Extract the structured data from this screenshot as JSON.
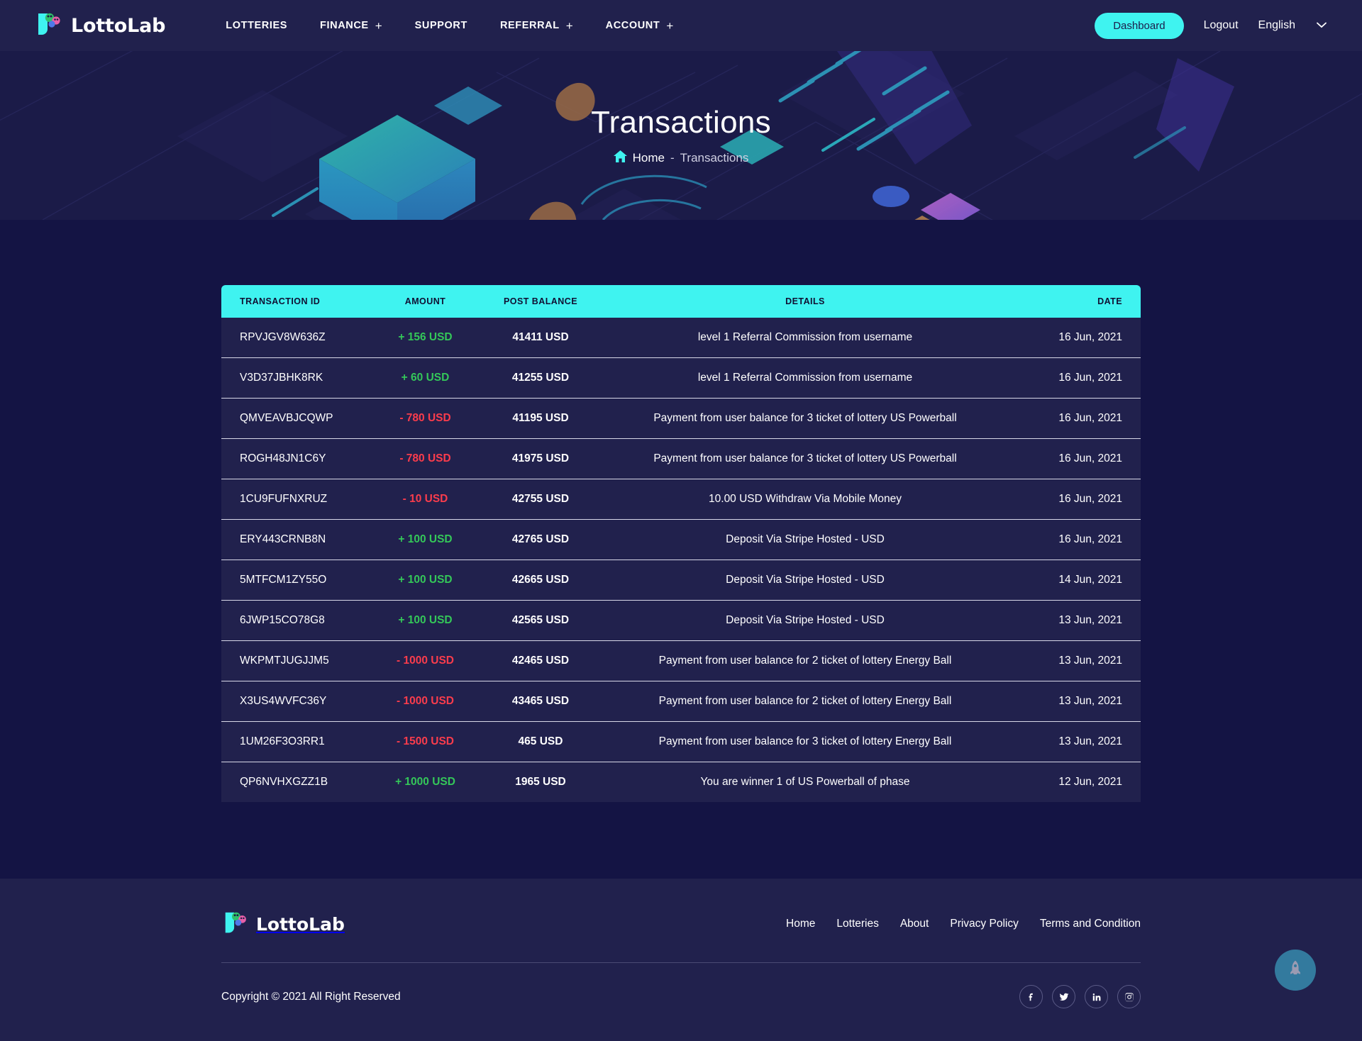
{
  "brand": {
    "name": "LottoLab"
  },
  "nav": {
    "items": [
      {
        "label": "LOTTERIES",
        "has_plus": false
      },
      {
        "label": "FINANCE",
        "has_plus": true
      },
      {
        "label": "SUPPORT",
        "has_plus": false
      },
      {
        "label": "REFERRAL",
        "has_plus": true
      },
      {
        "label": "ACCOUNT",
        "has_plus": true
      }
    ],
    "dashboard_label": "Dashboard",
    "logout_label": "Logout",
    "language_label": "English"
  },
  "banner": {
    "title": "Transactions",
    "breadcrumb_home": "Home",
    "breadcrumb_separator": "-",
    "breadcrumb_current": "Transactions"
  },
  "table": {
    "columns": [
      "TRANSACTION ID",
      "AMOUNT",
      "POST BALANCE",
      "DETAILS",
      "DATE"
    ],
    "rows": [
      {
        "id": "RPVJGV8W636Z",
        "amount": "+ 156 USD",
        "sign": "pos",
        "balance": "41411 USD",
        "details": "level 1 Referral Commission from username",
        "date": "16 Jun, 2021"
      },
      {
        "id": "V3D37JBHK8RK",
        "amount": "+ 60 USD",
        "sign": "pos",
        "balance": "41255 USD",
        "details": "level 1 Referral Commission from username",
        "date": "16 Jun, 2021"
      },
      {
        "id": "QMVEAVBJCQWP",
        "amount": "- 780 USD",
        "sign": "neg",
        "balance": "41195 USD",
        "details": "Payment from user balance for 3 ticket of lottery US Powerball",
        "date": "16 Jun, 2021"
      },
      {
        "id": "ROGH48JN1C6Y",
        "amount": "- 780 USD",
        "sign": "neg",
        "balance": "41975 USD",
        "details": "Payment from user balance for 3 ticket of lottery US Powerball",
        "date": "16 Jun, 2021"
      },
      {
        "id": "1CU9FUFNXRUZ",
        "amount": "- 10 USD",
        "sign": "neg",
        "balance": "42755 USD",
        "details": "10.00 USD Withdraw Via Mobile Money",
        "date": "16 Jun, 2021"
      },
      {
        "id": "ERY443CRNB8N",
        "amount": "+ 100 USD",
        "sign": "pos",
        "balance": "42765 USD",
        "details": "Deposit Via Stripe Hosted - USD",
        "date": "16 Jun, 2021"
      },
      {
        "id": "5MTFCM1ZY55O",
        "amount": "+ 100 USD",
        "sign": "pos",
        "balance": "42665 USD",
        "details": "Deposit Via Stripe Hosted - USD",
        "date": "14 Jun, 2021"
      },
      {
        "id": "6JWP15CO78G8",
        "amount": "+ 100 USD",
        "sign": "pos",
        "balance": "42565 USD",
        "details": "Deposit Via Stripe Hosted - USD",
        "date": "13 Jun, 2021"
      },
      {
        "id": "WKPMTJUGJJM5",
        "amount": "- 1000 USD",
        "sign": "neg",
        "balance": "42465 USD",
        "details": "Payment from user balance for 2 ticket of lottery Energy Ball",
        "date": "13 Jun, 2021"
      },
      {
        "id": "X3US4WVFC36Y",
        "amount": "- 1000 USD",
        "sign": "neg",
        "balance": "43465 USD",
        "details": "Payment from user balance for 2 ticket of lottery Energy Ball",
        "date": "13 Jun, 2021"
      },
      {
        "id": "1UM26F3O3RR1",
        "amount": "- 1500 USD",
        "sign": "neg",
        "balance": "465 USD",
        "details": "Payment from user balance for 3 ticket of lottery Energy Ball",
        "date": "13 Jun, 2021"
      },
      {
        "id": "QP6NVHXGZZ1B",
        "amount": "+ 1000 USD",
        "sign": "pos",
        "balance": "1965 USD",
        "details": "You are winner 1 of US Powerball of phase",
        "date": "12 Jun, 2021"
      }
    ]
  },
  "footer": {
    "brand": "LottoLab",
    "links": [
      "Home",
      "Lotteries",
      "About",
      "Privacy Policy",
      "Terms and Condition"
    ],
    "copyright": "Copyright © 2021 All Right Reserved",
    "socials": [
      "facebook-icon",
      "twitter-icon",
      "linkedin-icon",
      "instagram-icon"
    ]
  },
  "colors": {
    "accent": "#3ff3f0",
    "page_bg": "#141444",
    "panel_bg": "#21214d",
    "positive": "#34c759",
    "negative": "#fa3c4c",
    "balance": "#2aa9f0"
  }
}
